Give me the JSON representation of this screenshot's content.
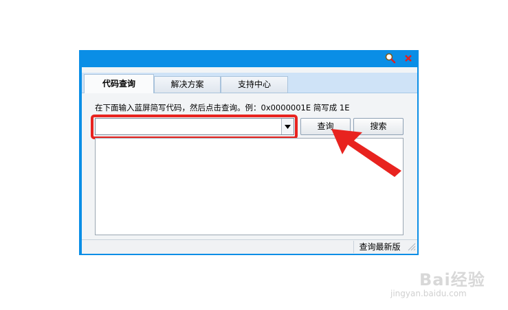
{
  "window": {
    "title_icons": [
      "search-icon",
      "close-icon"
    ],
    "accent_color": "#0a8ee6"
  },
  "tabs": [
    {
      "label": "代码查询",
      "active": true
    },
    {
      "label": "解决方案",
      "active": false
    },
    {
      "label": "支持中心",
      "active": false
    }
  ],
  "hint": "在下面输入蓝屏简写代码，然后点击查询。例：0x0000001E 简写成 1E",
  "code_input": {
    "value": "",
    "placeholder": ""
  },
  "buttons": {
    "query": "查询",
    "search": "搜索"
  },
  "status": {
    "update_link": "查询最新版"
  },
  "annotation": {
    "highlight_color": "#e8231f"
  },
  "watermark": {
    "brand": "Bai经验",
    "url": "jingyan.baidu.com"
  }
}
